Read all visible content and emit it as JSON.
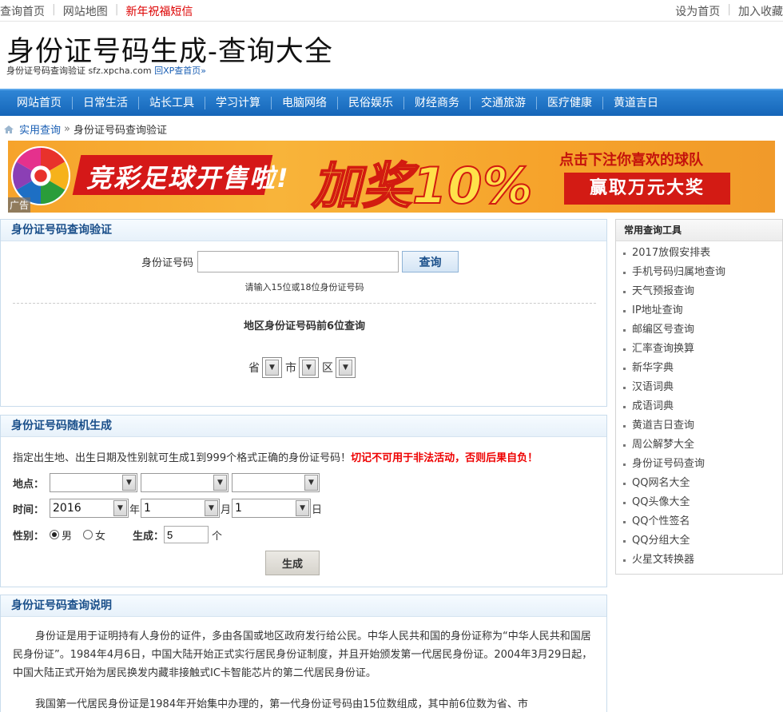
{
  "topbar": {
    "left": [
      "查询首页",
      "网站地图"
    ],
    "promo": "新年祝福短信",
    "right": [
      "设为首页",
      "加入收藏"
    ]
  },
  "header": {
    "title": "身份证号码生成-查询大全",
    "subtitle": "身份证号码查询验证 sfz.xpcha.com",
    "back_link": "回XP查首页»"
  },
  "nav": [
    "网站首页",
    "日常生活",
    "站长工具",
    "学习计算",
    "电脑网络",
    "民俗娱乐",
    "财经商务",
    "交通旅游",
    "医疗健康",
    "黄道吉日"
  ],
  "breadcrumb": {
    "parent": "实用查询",
    "sep": "»",
    "current": "身份证号码查询验证"
  },
  "banner": {
    "slogan": "竞彩足球开售啦!",
    "bonus": "加奖10%",
    "cta_top": "点击下注你喜欢的球队",
    "cta_bottom": "赢取万元大奖",
    "ad_tag": "广告"
  },
  "lookup": {
    "title": "身份证号码查询验证",
    "label": "身份证号码",
    "input_value": "",
    "button": "查询",
    "hint": "请输入15位或18位身份证号码",
    "area_title": "地区身份证号码前6位查询",
    "province": "省",
    "city": "市",
    "district": "区"
  },
  "generator": {
    "title": "身份证号码随机生成",
    "intro": "指定出生地、出生日期及性别就可生成1到999个格式正确的身份证号码！",
    "warning": "切记不可用于非法活动，否则后果自负！",
    "place_label": "地点：",
    "time_label": "时间：",
    "year": "2016",
    "year_unit": "年",
    "month": "1",
    "month_unit": "月",
    "day": "1",
    "day_unit": "日",
    "gender_label": "性别：",
    "male": "男",
    "female": "女",
    "gender_selected": "男",
    "count_label": "生成：",
    "count_value": "5",
    "count_unit": "个",
    "button": "生成"
  },
  "explain": {
    "title": "身份证号码查询说明",
    "p1": "身份证是用于证明持有人身份的证件，多由各国或地区政府发行给公民。中华人民共和国的身份证称为“中华人民共和国居民身份证”。1984年4月6日，中国大陆开始正式实行居民身份证制度，并且开始颁发第一代居民身份证。2004年3月29日起，中国大陆正式开始为居民换发内藏非接触式IC卡智能芯片的第二代居民身份证。",
    "p2": "我国第一代居民身份证是1984年开始集中办理的，第一代身份证号码由15位数组成，其中前6位数为省、市"
  },
  "tools": {
    "title": "常用查询工具",
    "items": [
      "2017放假安排表",
      "手机号码归属地查询",
      "天气预报查询",
      "IP地址查询",
      "邮编区号查询",
      "汇率查询换算",
      "新华字典",
      "汉语词典",
      "成语词典",
      "黄道吉日查询",
      "周公解梦大全",
      "身份证号码查询",
      "QQ网名大全",
      "QQ头像大全",
      "QQ个性签名",
      "QQ分组大全",
      "火星文转换器"
    ]
  },
  "colors": {
    "nav_blue": "#1565b8",
    "panel_title": "#1a4f8a",
    "warning_red": "#e00000",
    "banner_orange": "#f6a32b"
  }
}
